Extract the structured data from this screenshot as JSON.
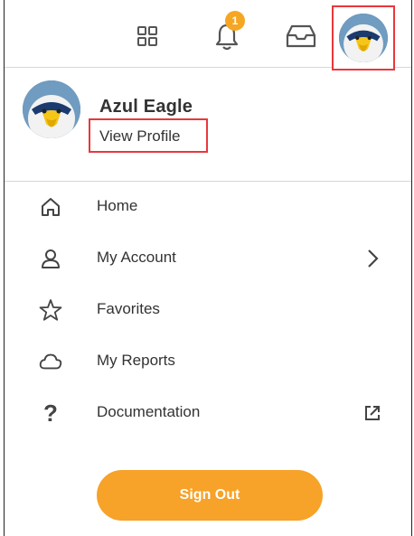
{
  "topbar": {
    "apps_icon": "apps-grid-icon",
    "notifications_icon": "bell-icon",
    "notifications_count": "1",
    "inbox_icon": "inbox-icon",
    "profile_avatar": "eagle-mascot-avatar"
  },
  "profile": {
    "name": "Azul Eagle",
    "view_profile_label": "View Profile"
  },
  "menu": {
    "items": [
      {
        "label": "Home",
        "icon": "home-icon"
      },
      {
        "label": "My Account",
        "icon": "user-icon",
        "trailing_icon": "chevron-right-icon"
      },
      {
        "label": "Favorites",
        "icon": "star-icon"
      },
      {
        "label": "My Reports",
        "icon": "cloud-icon"
      },
      {
        "label": "Documentation",
        "icon": "question-icon",
        "trailing_icon": "external-link-icon"
      }
    ]
  },
  "sign_out_label": "Sign Out",
  "colors": {
    "accent": "#f7a228",
    "highlight_border": "#e8383d",
    "badge": "#f5a623"
  }
}
